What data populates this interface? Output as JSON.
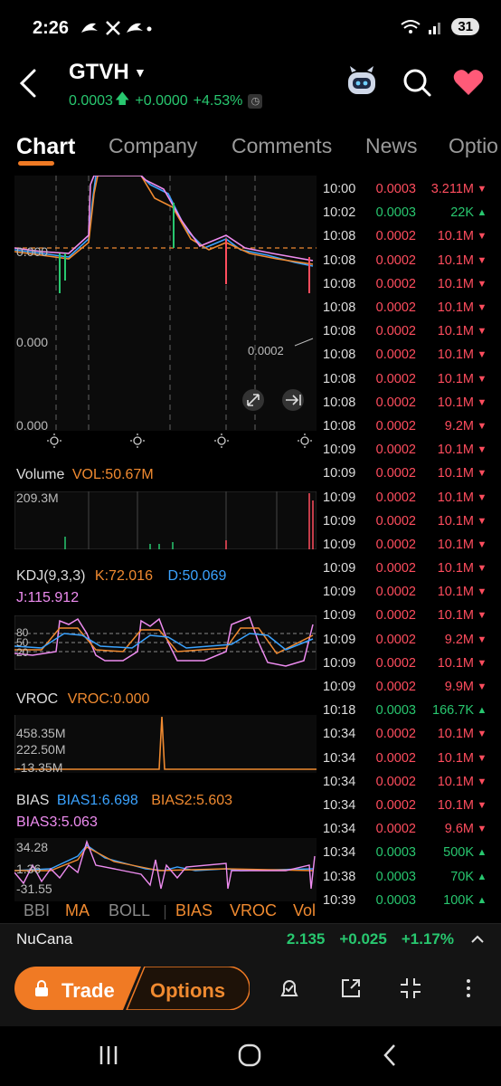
{
  "status_bar": {
    "time": "2:26",
    "notif_icons": "ຏ 𝕏 ຏ •",
    "battery": "31"
  },
  "header": {
    "ticker": "GTVH",
    "price": "0.0003",
    "change": "+0.0000",
    "change_pct": "+4.53%"
  },
  "tabs": [
    "Chart",
    "Company",
    "Comments",
    "News",
    "Optio"
  ],
  "chart": {
    "price_labels": [
      "0.000",
      "0.000",
      "0.000"
    ],
    "last_price_label": "0.0002",
    "volume": {
      "label": "Volume",
      "value": "VOL:50.67M",
      "max": "209.3M"
    },
    "kdj": {
      "label": "KDJ(9,3,3)",
      "k": "K:72.016",
      "d": "D:50.069",
      "j": "J:115.912",
      "levels": [
        "80",
        "50",
        "20"
      ]
    },
    "vroc": {
      "label": "VROC",
      "value": "VROC:0.000",
      "ticks": [
        "458.35M",
        "222.50M",
        "-13.35M"
      ]
    },
    "bias": {
      "label": "BIAS",
      "b1": "BIAS1:6.698",
      "b2": "BIAS2:5.603",
      "b3": "BIAS3:5.063",
      "ticks": [
        "34.28",
        "1.36",
        "-31.55"
      ]
    }
  },
  "indicators": [
    "BBI",
    "MA",
    "BOLL",
    "BIAS",
    "VROC",
    "Vol"
  ],
  "time_sales": [
    {
      "t": "10:00",
      "p": "0.0003",
      "v": "3.211M",
      "dir": "down"
    },
    {
      "t": "10:02",
      "p": "0.0003",
      "v": "22K",
      "dir": "up"
    },
    {
      "t": "10:08",
      "p": "0.0002",
      "v": "10.1M",
      "dir": "down"
    },
    {
      "t": "10:08",
      "p": "0.0002",
      "v": "10.1M",
      "dir": "down"
    },
    {
      "t": "10:08",
      "p": "0.0002",
      "v": "10.1M",
      "dir": "down"
    },
    {
      "t": "10:08",
      "p": "0.0002",
      "v": "10.1M",
      "dir": "down"
    },
    {
      "t": "10:08",
      "p": "0.0002",
      "v": "10.1M",
      "dir": "down"
    },
    {
      "t": "10:08",
      "p": "0.0002",
      "v": "10.1M",
      "dir": "down"
    },
    {
      "t": "10:08",
      "p": "0.0002",
      "v": "10.1M",
      "dir": "down"
    },
    {
      "t": "10:08",
      "p": "0.0002",
      "v": "10.1M",
      "dir": "down"
    },
    {
      "t": "10:08",
      "p": "0.0002",
      "v": "9.2M",
      "dir": "down"
    },
    {
      "t": "10:09",
      "p": "0.0002",
      "v": "10.1M",
      "dir": "down"
    },
    {
      "t": "10:09",
      "p": "0.0002",
      "v": "10.1M",
      "dir": "down"
    },
    {
      "t": "10:09",
      "p": "0.0002",
      "v": "10.1M",
      "dir": "down"
    },
    {
      "t": "10:09",
      "p": "0.0002",
      "v": "10.1M",
      "dir": "down"
    },
    {
      "t": "10:09",
      "p": "0.0002",
      "v": "10.1M",
      "dir": "down"
    },
    {
      "t": "10:09",
      "p": "0.0002",
      "v": "10.1M",
      "dir": "down"
    },
    {
      "t": "10:09",
      "p": "0.0002",
      "v": "10.1M",
      "dir": "down"
    },
    {
      "t": "10:09",
      "p": "0.0002",
      "v": "10.1M",
      "dir": "down"
    },
    {
      "t": "10:09",
      "p": "0.0002",
      "v": "9.2M",
      "dir": "down"
    },
    {
      "t": "10:09",
      "p": "0.0002",
      "v": "10.1M",
      "dir": "down"
    },
    {
      "t": "10:09",
      "p": "0.0002",
      "v": "9.9M",
      "dir": "down"
    },
    {
      "t": "10:18",
      "p": "0.0003",
      "v": "166.7K",
      "dir": "up"
    },
    {
      "t": "10:34",
      "p": "0.0002",
      "v": "10.1M",
      "dir": "down"
    },
    {
      "t": "10:34",
      "p": "0.0002",
      "v": "10.1M",
      "dir": "down"
    },
    {
      "t": "10:34",
      "p": "0.0002",
      "v": "10.1M",
      "dir": "down"
    },
    {
      "t": "10:34",
      "p": "0.0002",
      "v": "10.1M",
      "dir": "down"
    },
    {
      "t": "10:34",
      "p": "0.0002",
      "v": "9.6M",
      "dir": "down"
    },
    {
      "t": "10:34",
      "p": "0.0003",
      "v": "500K",
      "dir": "up"
    },
    {
      "t": "10:38",
      "p": "0.0003",
      "v": "70K",
      "dir": "up"
    },
    {
      "t": "10:39",
      "p": "0.0003",
      "v": "100K",
      "dir": "up"
    }
  ],
  "bottom_strip": {
    "name": "NuCana",
    "price": "2.135",
    "change": "+0.025",
    "change_pct": "+1.17%"
  },
  "toolbar": {
    "trade": "Trade",
    "options": "Options"
  },
  "colors": {
    "up": "#28c76f",
    "down": "#ff4d5e",
    "accent": "#f07a24"
  }
}
